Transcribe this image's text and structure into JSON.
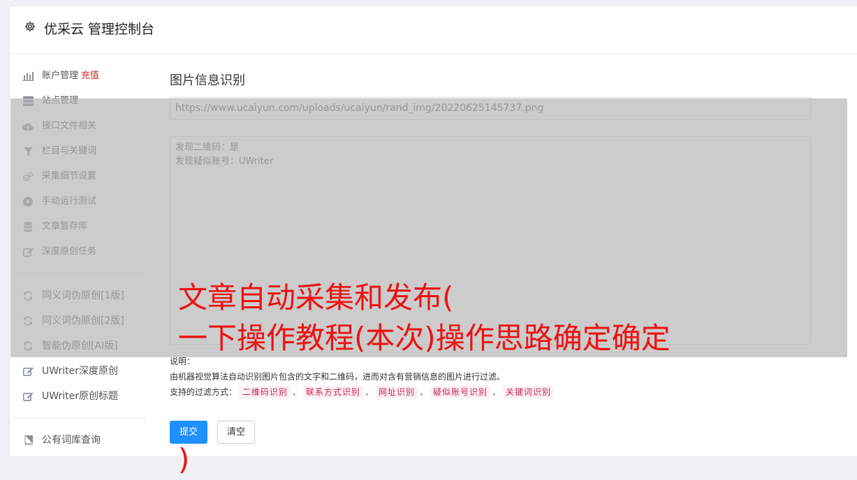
{
  "header": {
    "title": "优采云 管理控制台",
    "icon": "gear-icon"
  },
  "sidebar": {
    "items": [
      {
        "label": "账户管理",
        "badge": "充值",
        "icon": "bar-chart-icon"
      },
      {
        "label": "站点管理",
        "icon": "server-icon"
      },
      {
        "label": "接口文件相关",
        "icon": "cloud-upload-icon"
      },
      {
        "label": "栏目与关键词",
        "icon": "filter-icon"
      },
      {
        "label": "采集细节设置",
        "icon": "gears-icon"
      },
      {
        "label": "手动运行测试",
        "icon": "play-circle-icon"
      },
      {
        "label": "文章暂存库",
        "icon": "database-icon"
      },
      {
        "label": "深度原创任务",
        "icon": "edit-icon"
      }
    ],
    "items2": [
      {
        "label": "同义词伪原创[1版]",
        "icon": "refresh-icon"
      },
      {
        "label": "同义词伪原创[2版]",
        "icon": "refresh-icon"
      },
      {
        "label": "智能伪原创[AI版]",
        "icon": "refresh-icon"
      },
      {
        "label": "UWriter深度原创",
        "icon": "edit-icon"
      },
      {
        "label": "UWriter原创标题",
        "icon": "edit-icon"
      }
    ],
    "items3": [
      {
        "label": "公有词库查询",
        "icon": "book-icon"
      }
    ]
  },
  "main": {
    "section_title": "图片信息识别",
    "url_value": "https://www.ucaiyun.com/uploads/ucaiyun/rand_img/20220625145737.png",
    "result_text": "发现二维码：是\n发现疑似账号：UWriter",
    "notes_title": "说明：",
    "notes_desc": "由机器视觉算法自动识别图片包含的文字和二维码，进而对含有营销信息的图片进行过滤。",
    "filter_label": "支持的过滤方式：",
    "filters": [
      "二维码识别",
      "联系方式识别",
      "网址识别",
      "疑似账号识别",
      "关键词识别"
    ],
    "filter_sep": "、",
    "submit_label": "提交",
    "clear_label": "清空"
  },
  "overlay": {
    "line1": "文章自动采集和发布(",
    "line2": "一下操作教程(本次)操作思路确定确定",
    "line3": ")"
  },
  "colors": {
    "accent": "#1e90ff",
    "badge": "#e0211b",
    "tag_text": "#c7254e",
    "overlay_text": "#ee1111"
  }
}
